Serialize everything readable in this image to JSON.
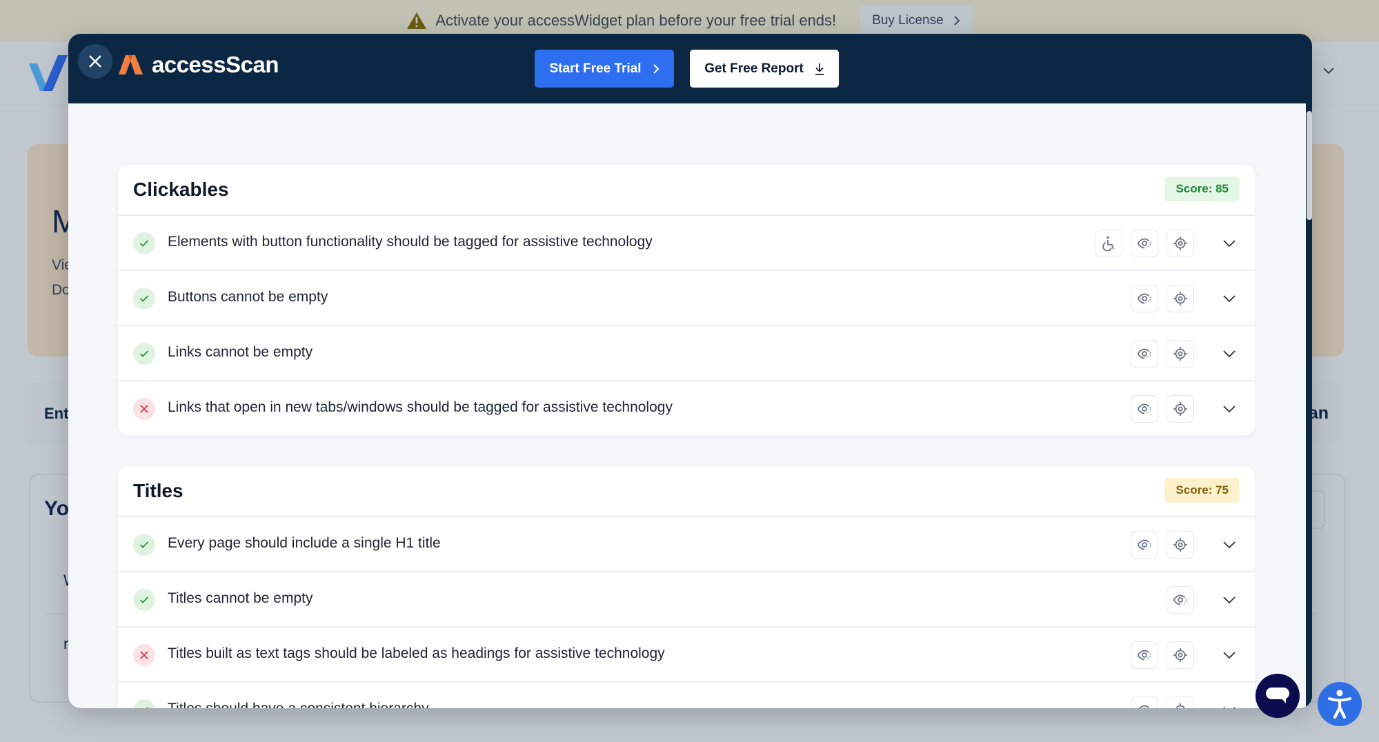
{
  "banner": {
    "message": "Activate your accessWidget plan before your free trial ends!",
    "buy_label": "Buy License",
    "icon": "warning-triangle-icon"
  },
  "background_page": {
    "hero_title_fragment": "M",
    "hero_line1_fragment": "Vie",
    "hero_line2_fragment": "Do",
    "enter_fragment": "Ent",
    "enter_right_fragment": "an",
    "your_fragment": "Yo",
    "row1_fragment": "W",
    "row2_fragment": "r"
  },
  "modal": {
    "brand_name": "accessScan",
    "close_icon": "close-icon",
    "start_trial_label": "Start Free Trial",
    "get_report_label": "Get Free Report",
    "colors": {
      "header": "#0c2744",
      "primary": "#2d6ff0",
      "pass": "#18862e",
      "fail": "#e0323e"
    }
  },
  "sections": [
    {
      "title": "Clickables",
      "score_label": "Score: 85",
      "score_level": "good",
      "rows": [
        {
          "status": "pass",
          "text": "Elements with button functionality should be tagged for assistive technology",
          "actions": [
            "accessibility",
            "view",
            "locate"
          ]
        },
        {
          "status": "pass",
          "text": "Buttons cannot be empty",
          "actions": [
            "view",
            "locate"
          ]
        },
        {
          "status": "pass",
          "text": "Links cannot be empty",
          "actions": [
            "view",
            "locate"
          ]
        },
        {
          "status": "fail",
          "text": "Links that open in new tabs/windows should be tagged for assistive technology",
          "actions": [
            "view",
            "locate"
          ]
        }
      ]
    },
    {
      "title": "Titles",
      "score_label": "Score: 75",
      "score_level": "warn",
      "rows": [
        {
          "status": "pass",
          "text": "Every page should include a single H1 title",
          "actions": [
            "view",
            "locate"
          ]
        },
        {
          "status": "pass",
          "text": "Titles cannot be empty",
          "actions": [
            "view"
          ]
        },
        {
          "status": "fail",
          "text": "Titles built as text tags should be labeled as headings for assistive technology",
          "actions": [
            "view",
            "locate"
          ]
        },
        {
          "status": "pass",
          "text": "Titles should have a consistent hierarchy",
          "actions": [
            "view",
            "locate"
          ]
        }
      ]
    }
  ],
  "floating": {
    "chat_icon": "chat-bubble-icon",
    "accessibility_icon": "accessibility-person-icon"
  }
}
